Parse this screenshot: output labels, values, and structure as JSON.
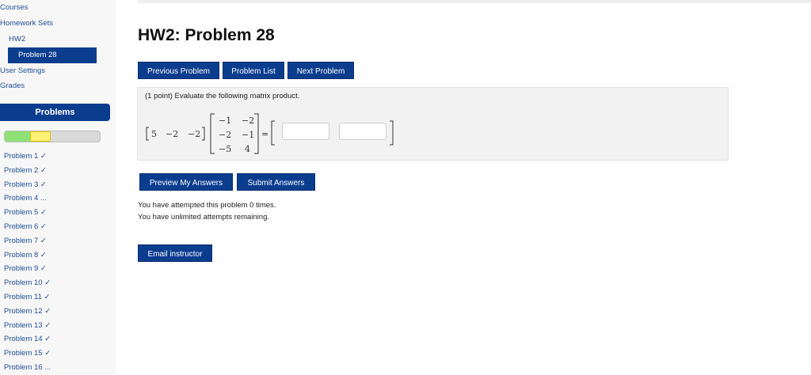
{
  "sidebar": {
    "nav": [
      {
        "label": "Courses"
      },
      {
        "label": "Homework Sets"
      },
      {
        "label": "HW2"
      },
      {
        "label": "Problem 28"
      },
      {
        "label": "User Settings"
      },
      {
        "label": "Grades"
      }
    ],
    "problems_header": "Problems",
    "progress": {
      "correct_fraction": 0.4,
      "attempted_fraction": 0.44
    },
    "problems": [
      "Problem 1 ✓",
      "Problem 2 ✓",
      "Problem 3 ✓",
      "Problem 4 ...",
      "Problem 5 ✓",
      "Problem 6 ✓",
      "Problem 7 ✓",
      "Problem 8 ✓",
      "Problem 9 ✓",
      "Problem 10 ✓",
      "Problem 11 ✓",
      "Problem 12 ✓",
      "Problem 13 ✓",
      "Problem 14 ✓",
      "Problem 15 ✓",
      "Problem 16 ..."
    ]
  },
  "main": {
    "title": "HW2: Problem 28",
    "nav_buttons": {
      "previous": "Previous Problem",
      "list": "Problem List",
      "next": "Next Problem"
    },
    "problem": {
      "statement": "(1 point) Evaluate the following matrix product.",
      "row_vector": [
        "5",
        "−2",
        "−2"
      ],
      "matrix": [
        [
          "−1",
          "−2"
        ],
        [
          "−2",
          "−1"
        ],
        [
          "−5",
          "4"
        ]
      ],
      "equals": "=",
      "answer_values": [
        "",
        ""
      ]
    },
    "action_buttons": {
      "preview": "Preview My Answers",
      "submit": "Submit Answers"
    },
    "attempts": {
      "line1": "You have attempted this problem 0 times.",
      "line2": "You have unlimited attempts remaining."
    },
    "email_button": "Email instructor"
  },
  "colors": {
    "primary": "#0b3d8f",
    "link": "#1f4e99",
    "correct": "#8fe075",
    "partial": "#fff176"
  }
}
